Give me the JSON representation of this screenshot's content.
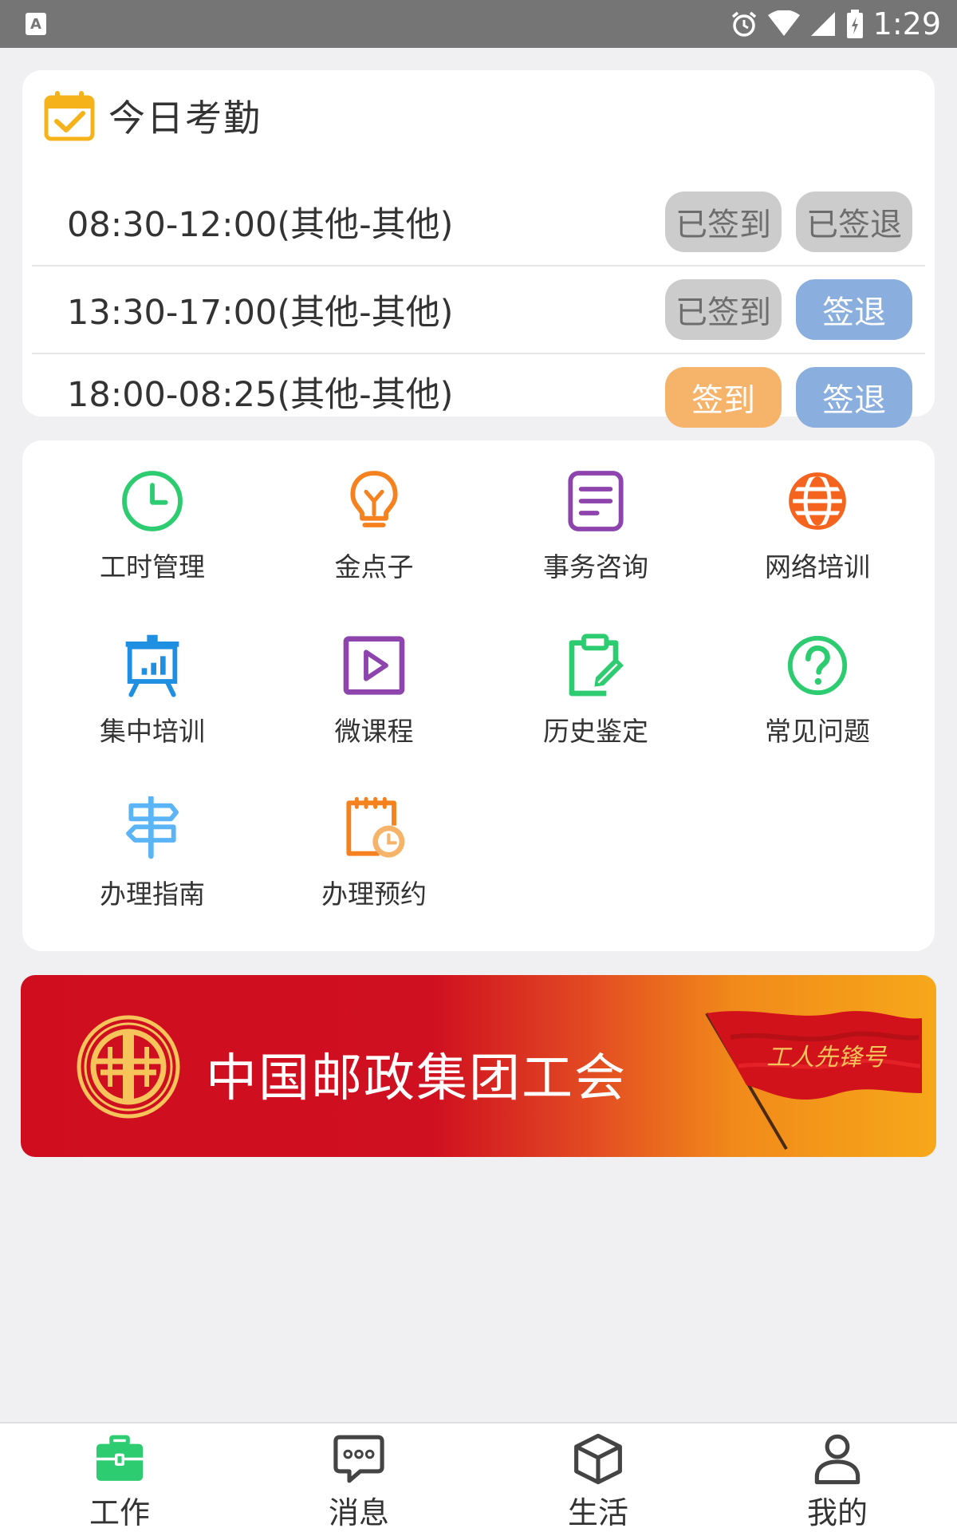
{
  "status_bar": {
    "time": "1:29",
    "icons": [
      "app-a-icon",
      "alarm-icon",
      "wifi-icon",
      "signal-icon",
      "battery-icon"
    ]
  },
  "attendance": {
    "title": "今日考勤",
    "icon": "calendar-check-icon",
    "rows": [
      {
        "time": "08:30-12:00(其他-其他)",
        "sign_in": {
          "label": "已签到",
          "state": "done"
        },
        "sign_out": {
          "label": "已签退",
          "state": "done"
        }
      },
      {
        "time": "13:30-17:00(其他-其他)",
        "sign_in": {
          "label": "已签到",
          "state": "done"
        },
        "sign_out": {
          "label": "签退",
          "state": "available"
        }
      },
      {
        "time": "18:00-08:25(其他-其他)",
        "sign_in": {
          "label": "签到",
          "state": "available"
        },
        "sign_out": {
          "label": "签退",
          "state": "available"
        }
      }
    ]
  },
  "features": [
    {
      "label": "工时管理",
      "icon": "clock-icon",
      "color": "#2ecc71"
    },
    {
      "label": "金点子",
      "icon": "lightbulb-icon",
      "color": "#f5811f"
    },
    {
      "label": "事务咨询",
      "icon": "document-icon",
      "color": "#8e44ad"
    },
    {
      "label": "网络培训",
      "icon": "globe-icon",
      "color": "#f5641f"
    },
    {
      "label": "集中培训",
      "icon": "presentation-board-icon",
      "color": "#1e8fe1"
    },
    {
      "label": "微课程",
      "icon": "play-video-icon",
      "color": "#8e44ad"
    },
    {
      "label": "历史鉴定",
      "icon": "clipboard-edit-icon",
      "color": "#2ecc71"
    },
    {
      "label": "常见问题",
      "icon": "question-circle-icon",
      "color": "#2ecc71"
    },
    {
      "label": "办理指南",
      "icon": "signpost-icon",
      "color": "#5bb4f5"
    },
    {
      "label": "办理预约",
      "icon": "notepad-clock-icon",
      "color": "#f5811f"
    }
  ],
  "banner": {
    "text": "中国邮政集团工会",
    "flag_text": "工人先锋号"
  },
  "tabs": [
    {
      "label": "工作",
      "icon": "briefcase-icon",
      "active": true
    },
    {
      "label": "消息",
      "icon": "chat-bubble-icon",
      "active": false
    },
    {
      "label": "生活",
      "icon": "cube-icon",
      "active": false
    },
    {
      "label": "我的",
      "icon": "user-icon",
      "active": false
    }
  ],
  "colors": {
    "accent_green": "#2ecc71",
    "btn_done": "#cccccc",
    "btn_blue": "#8aaedd",
    "btn_orange": "#f6b46a",
    "banner_red": "#cf0d1f",
    "banner_orange": "#f7a81a"
  }
}
